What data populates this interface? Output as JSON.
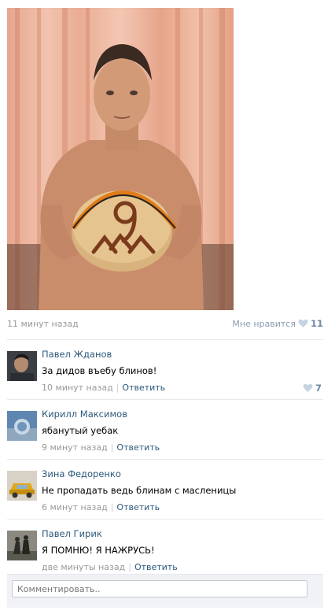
{
  "post": {
    "time": "11 минут назад",
    "like_label": "Мне нравится",
    "like_count": "11"
  },
  "comments": [
    {
      "author": "Павел Жданов",
      "text": "За дидов въебу блинов!",
      "time": "10 минут назад",
      "reply_label": "Ответить",
      "like_count": "7"
    },
    {
      "author": "Кирилл Максимов",
      "text": "ябанутый уебак",
      "time": "9 минут назад",
      "reply_label": "Ответить"
    },
    {
      "author": "Зина Федоренко",
      "text": "Не пропадать ведь блинам с масленицы",
      "time": "6 минут назад",
      "reply_label": "Ответить"
    },
    {
      "author": "Павел Гирик",
      "text": "Я ПОМНЮ! Я НАЖРУСЬ!",
      "time": "две минуты назад",
      "reply_label": "Ответить"
    }
  ],
  "composer": {
    "placeholder": "Комментировать.."
  },
  "icons": {
    "like": "heart-icon"
  },
  "colors": {
    "link": "#2b587a",
    "muted": "#999999",
    "like_count": "#6f87a3"
  }
}
